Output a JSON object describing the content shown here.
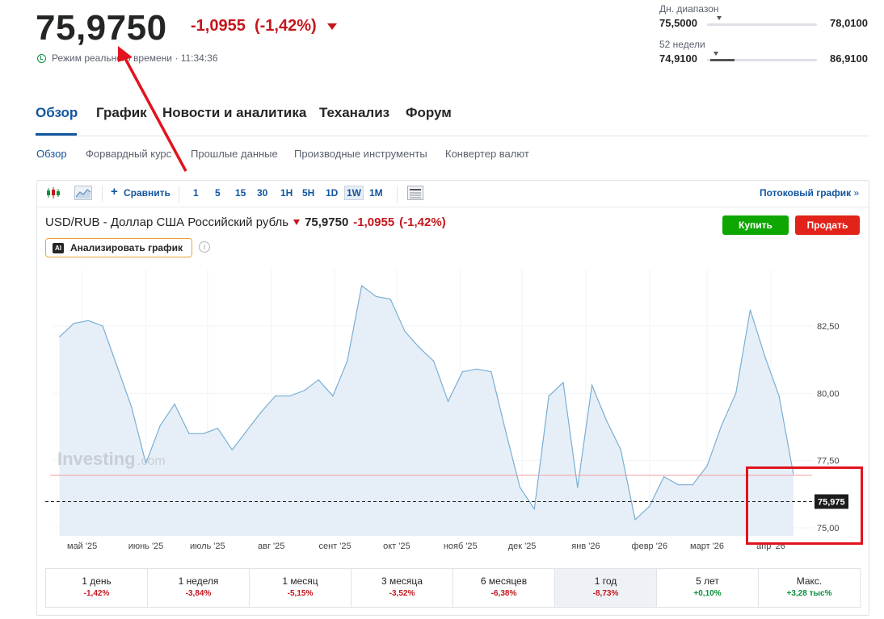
{
  "quote": {
    "price": "75,9750",
    "change": "-1,0955",
    "change_pct": "(-1,42%)",
    "realtime_label": "Режим реального времени",
    "realtime_sep": " · ",
    "time": "11:34:36"
  },
  "ranges": {
    "day": {
      "label": "Дн. диапазон",
      "low": "75,5000",
      "high": "78,0100",
      "position": 0.11
    },
    "week52": {
      "label": "52 недели",
      "low": "74,9100",
      "high": "86,9100",
      "position": 0.08
    }
  },
  "tabs": [
    "Обзор",
    "График",
    "Новости и аналитика",
    "Теханализ",
    "Форум"
  ],
  "subnav": [
    "Обзор",
    "Форвардный курс",
    "Прошлые данные",
    "Производные инструменты",
    "Конвертер валют"
  ],
  "toolbar": {
    "compare": "Сравнить",
    "intervals": [
      "1",
      "5",
      "15",
      "30",
      "1H",
      "5H",
      "1D",
      "1W",
      "1M"
    ],
    "selected_interval": "1W",
    "streaming": "Потоковый график",
    "streaming_chevron": "»"
  },
  "symbol": {
    "title": "USD/RUB - Доллар США Российский рубль",
    "price": "75,9750",
    "change": "-1,0955",
    "change_pct": "(-1,42%)"
  },
  "actions": {
    "buy": "Купить",
    "sell": "Продать",
    "ai": "Анализировать график",
    "ai_badge": "AI",
    "info": "i"
  },
  "watermark": {
    "brand": "Investing",
    "suffix": ".com"
  },
  "chart_data": {
    "type": "area",
    "x": [
      "2025-04-20",
      "2025-04-27",
      "2025-05-04",
      "2025-05-11",
      "2025-05-18",
      "2025-05-25",
      "2025-06-01",
      "2025-06-08",
      "2025-06-15",
      "2025-06-22",
      "2025-06-29",
      "2025-07-06",
      "2025-07-13",
      "2025-07-20",
      "2025-07-27",
      "2025-08-03",
      "2025-08-10",
      "2025-08-17",
      "2025-08-24",
      "2025-08-31",
      "2025-09-07",
      "2025-09-14",
      "2025-09-21",
      "2025-09-28",
      "2025-10-05",
      "2025-10-12",
      "2025-10-19",
      "2025-10-26",
      "2025-11-02",
      "2025-11-09",
      "2025-11-16",
      "2025-11-23",
      "2025-11-30",
      "2025-12-07",
      "2025-12-14",
      "2025-12-21",
      "2025-12-28",
      "2026-01-04",
      "2026-01-11",
      "2026-01-18",
      "2026-01-25",
      "2026-02-01",
      "2026-02-08",
      "2026-02-15",
      "2026-02-22",
      "2026-03-01",
      "2026-03-08",
      "2026-03-15",
      "2026-03-22",
      "2026-03-29",
      "2026-04-05",
      "2026-04-12"
    ],
    "values": [
      82.1,
      82.6,
      82.7,
      82.5,
      81.0,
      79.5,
      77.4,
      78.8,
      79.6,
      78.5,
      78.5,
      78.7,
      77.9,
      78.6,
      79.3,
      79.9,
      79.9,
      80.1,
      80.5,
      79.9,
      81.2,
      84.0,
      83.6,
      83.5,
      82.3,
      81.7,
      81.2,
      79.7,
      80.8,
      80.9,
      80.8,
      78.6,
      76.5,
      75.7,
      79.9,
      80.4,
      76.5,
      80.3,
      79.0,
      77.9,
      75.3,
      75.8,
      76.9,
      76.6,
      76.6,
      77.3,
      78.8,
      80.0,
      83.1,
      81.4,
      79.9,
      77.0
    ],
    "last_value": "75,975",
    "last_value_num": 75.975,
    "reference_line": 76.95,
    "y_ticks": [
      "82,50",
      "80,00",
      "77,50",
      "75,00"
    ],
    "y_tick_values": [
      82.5,
      80.0,
      77.5,
      75.0
    ],
    "x_tick_labels": [
      "май '25",
      "июнь '25",
      "июль '25",
      "авг '25",
      "сент '25",
      "окт '25",
      "нояб '25",
      "дек '25",
      "янв '26",
      "февр '26",
      "март '26",
      "апр '26"
    ],
    "x_tick_dates": [
      "2025-05-01",
      "2025-06-01",
      "2025-07-01",
      "2025-08-01",
      "2025-09-01",
      "2025-10-01",
      "2025-11-01",
      "2025-12-01",
      "2026-01-01",
      "2026-02-01",
      "2026-03-01",
      "2026-04-01"
    ],
    "ylim": [
      74.7,
      84.6
    ],
    "grid": true,
    "colors": {
      "line": "#7aaed4",
      "fill": "#e6eff7",
      "reference": "#f2a0a0",
      "label_bg": "#1c1c1c"
    }
  },
  "periods": [
    {
      "label": "1 день",
      "value": "-1,42%",
      "dir": "neg"
    },
    {
      "label": "1 неделя",
      "value": "-3,84%",
      "dir": "neg"
    },
    {
      "label": "1 месяц",
      "value": "-5,15%",
      "dir": "neg"
    },
    {
      "label": "3 месяца",
      "value": "-3,52%",
      "dir": "neg"
    },
    {
      "label": "6 месяцев",
      "value": "-6,38%",
      "dir": "neg"
    },
    {
      "label": "1 год",
      "value": "-8,73%",
      "dir": "neg",
      "selected": true
    },
    {
      "label": "5 лет",
      "value": "+0,10%",
      "dir": "pos"
    },
    {
      "label": "Макс.",
      "value": "+3,28 тыс%",
      "dir": "pos"
    }
  ],
  "colors": {
    "accent": "#1256a0",
    "negative": "#c4161c",
    "positive": "#0a8f3c",
    "buy": "#0ea600",
    "sell": "#e2231a",
    "annotation": "#e0141e"
  }
}
